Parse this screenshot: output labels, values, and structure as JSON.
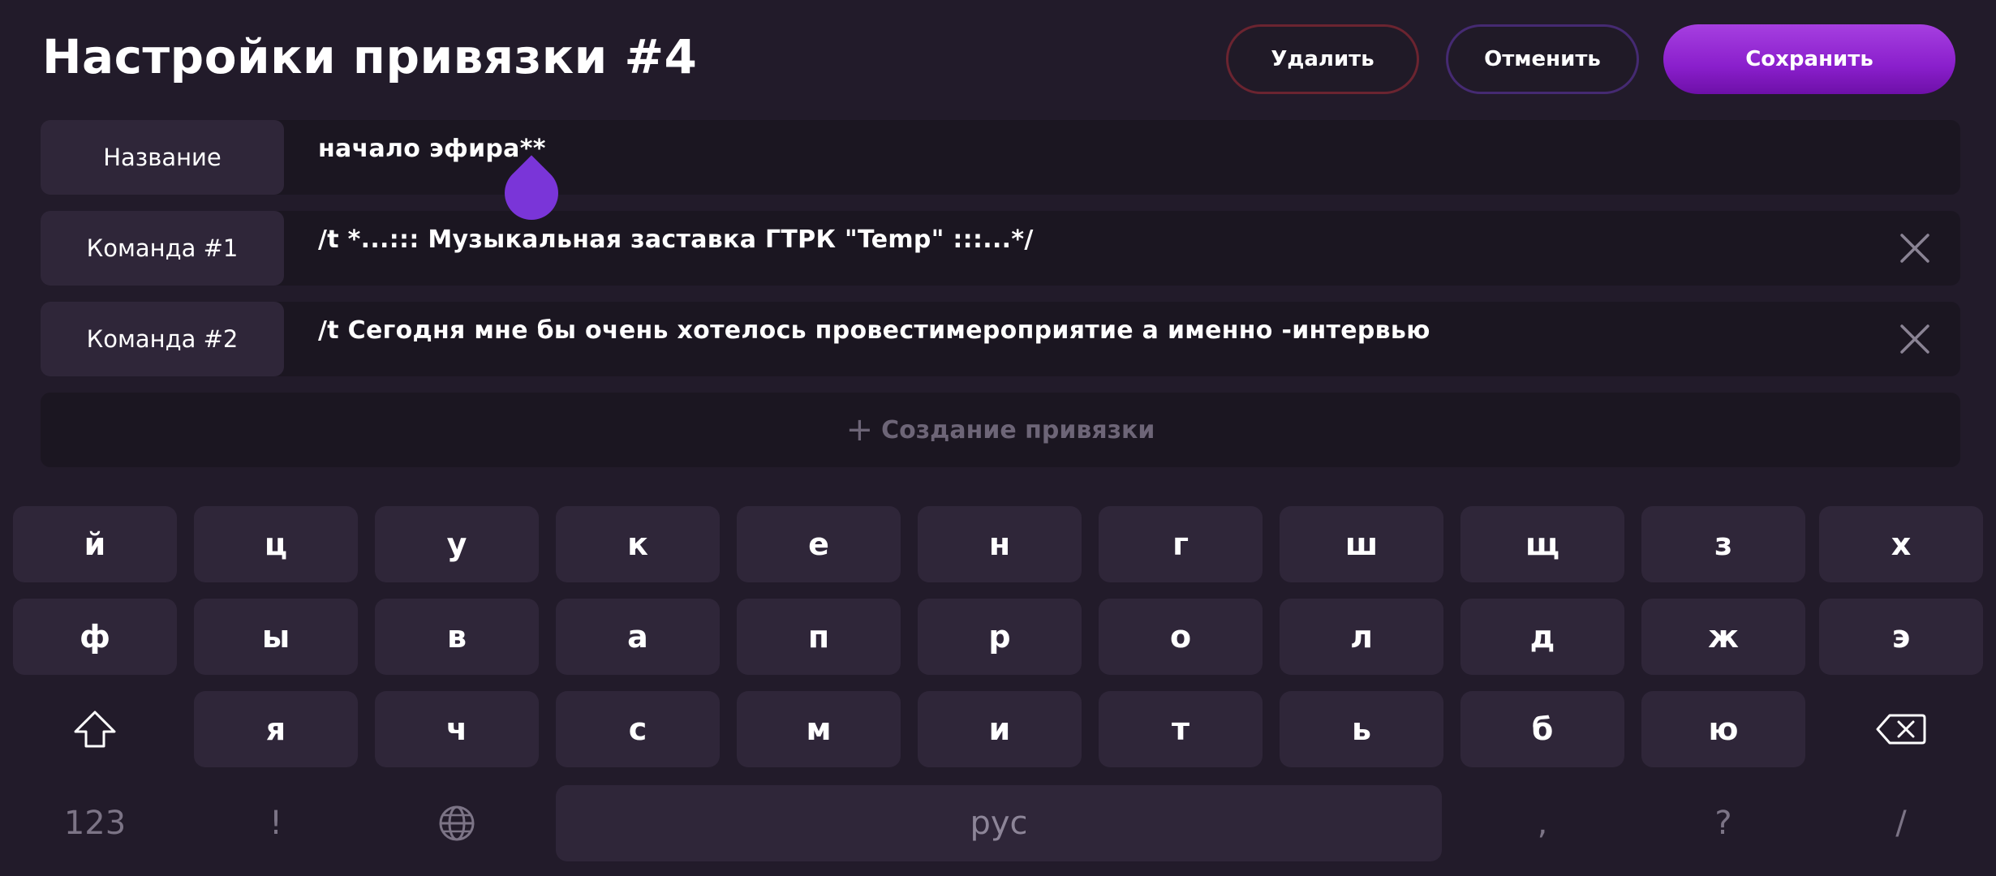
{
  "header": {
    "title": "Настройки привязки #4",
    "delete_label": "Удалить",
    "cancel_label": "Отменить",
    "save_label": "Сохранить"
  },
  "rows": [
    {
      "label": "Название",
      "value": "начало эфира**"
    },
    {
      "label": "Команда #1",
      "value": "/t *...::: Музыкальная заставка ГТРК \"Temp\" :::...*/"
    },
    {
      "label": "Команда #2",
      "value": "/t Сегодня мне бы очень хотелось провестимероприятие а именно -интервью"
    }
  ],
  "create_label": "Создание привязки",
  "keyboard": {
    "row1": [
      "й",
      "ц",
      "у",
      "к",
      "е",
      "н",
      "г",
      "ш",
      "щ",
      "з",
      "х"
    ],
    "row2": [
      "ф",
      "ы",
      "в",
      "а",
      "п",
      "р",
      "о",
      "л",
      "д",
      "ж",
      "э"
    ],
    "row3": [
      "я",
      "ч",
      "с",
      "м",
      "и",
      "т",
      "ь",
      "б",
      "ю"
    ],
    "row4": {
      "numbers": "123",
      "excl": "!",
      "space": "рус",
      "comma": ",",
      "question": "?",
      "slash": "/"
    },
    "icons": {
      "shift": "shift-icon",
      "backspace": "backspace-icon",
      "language": "globe-icon"
    }
  },
  "colors": {
    "background": "#221b2a",
    "accent": "#8a1fcc",
    "key": "#2f2639",
    "delete_border": "#6b2430",
    "cancel_border": "#452a72"
  }
}
